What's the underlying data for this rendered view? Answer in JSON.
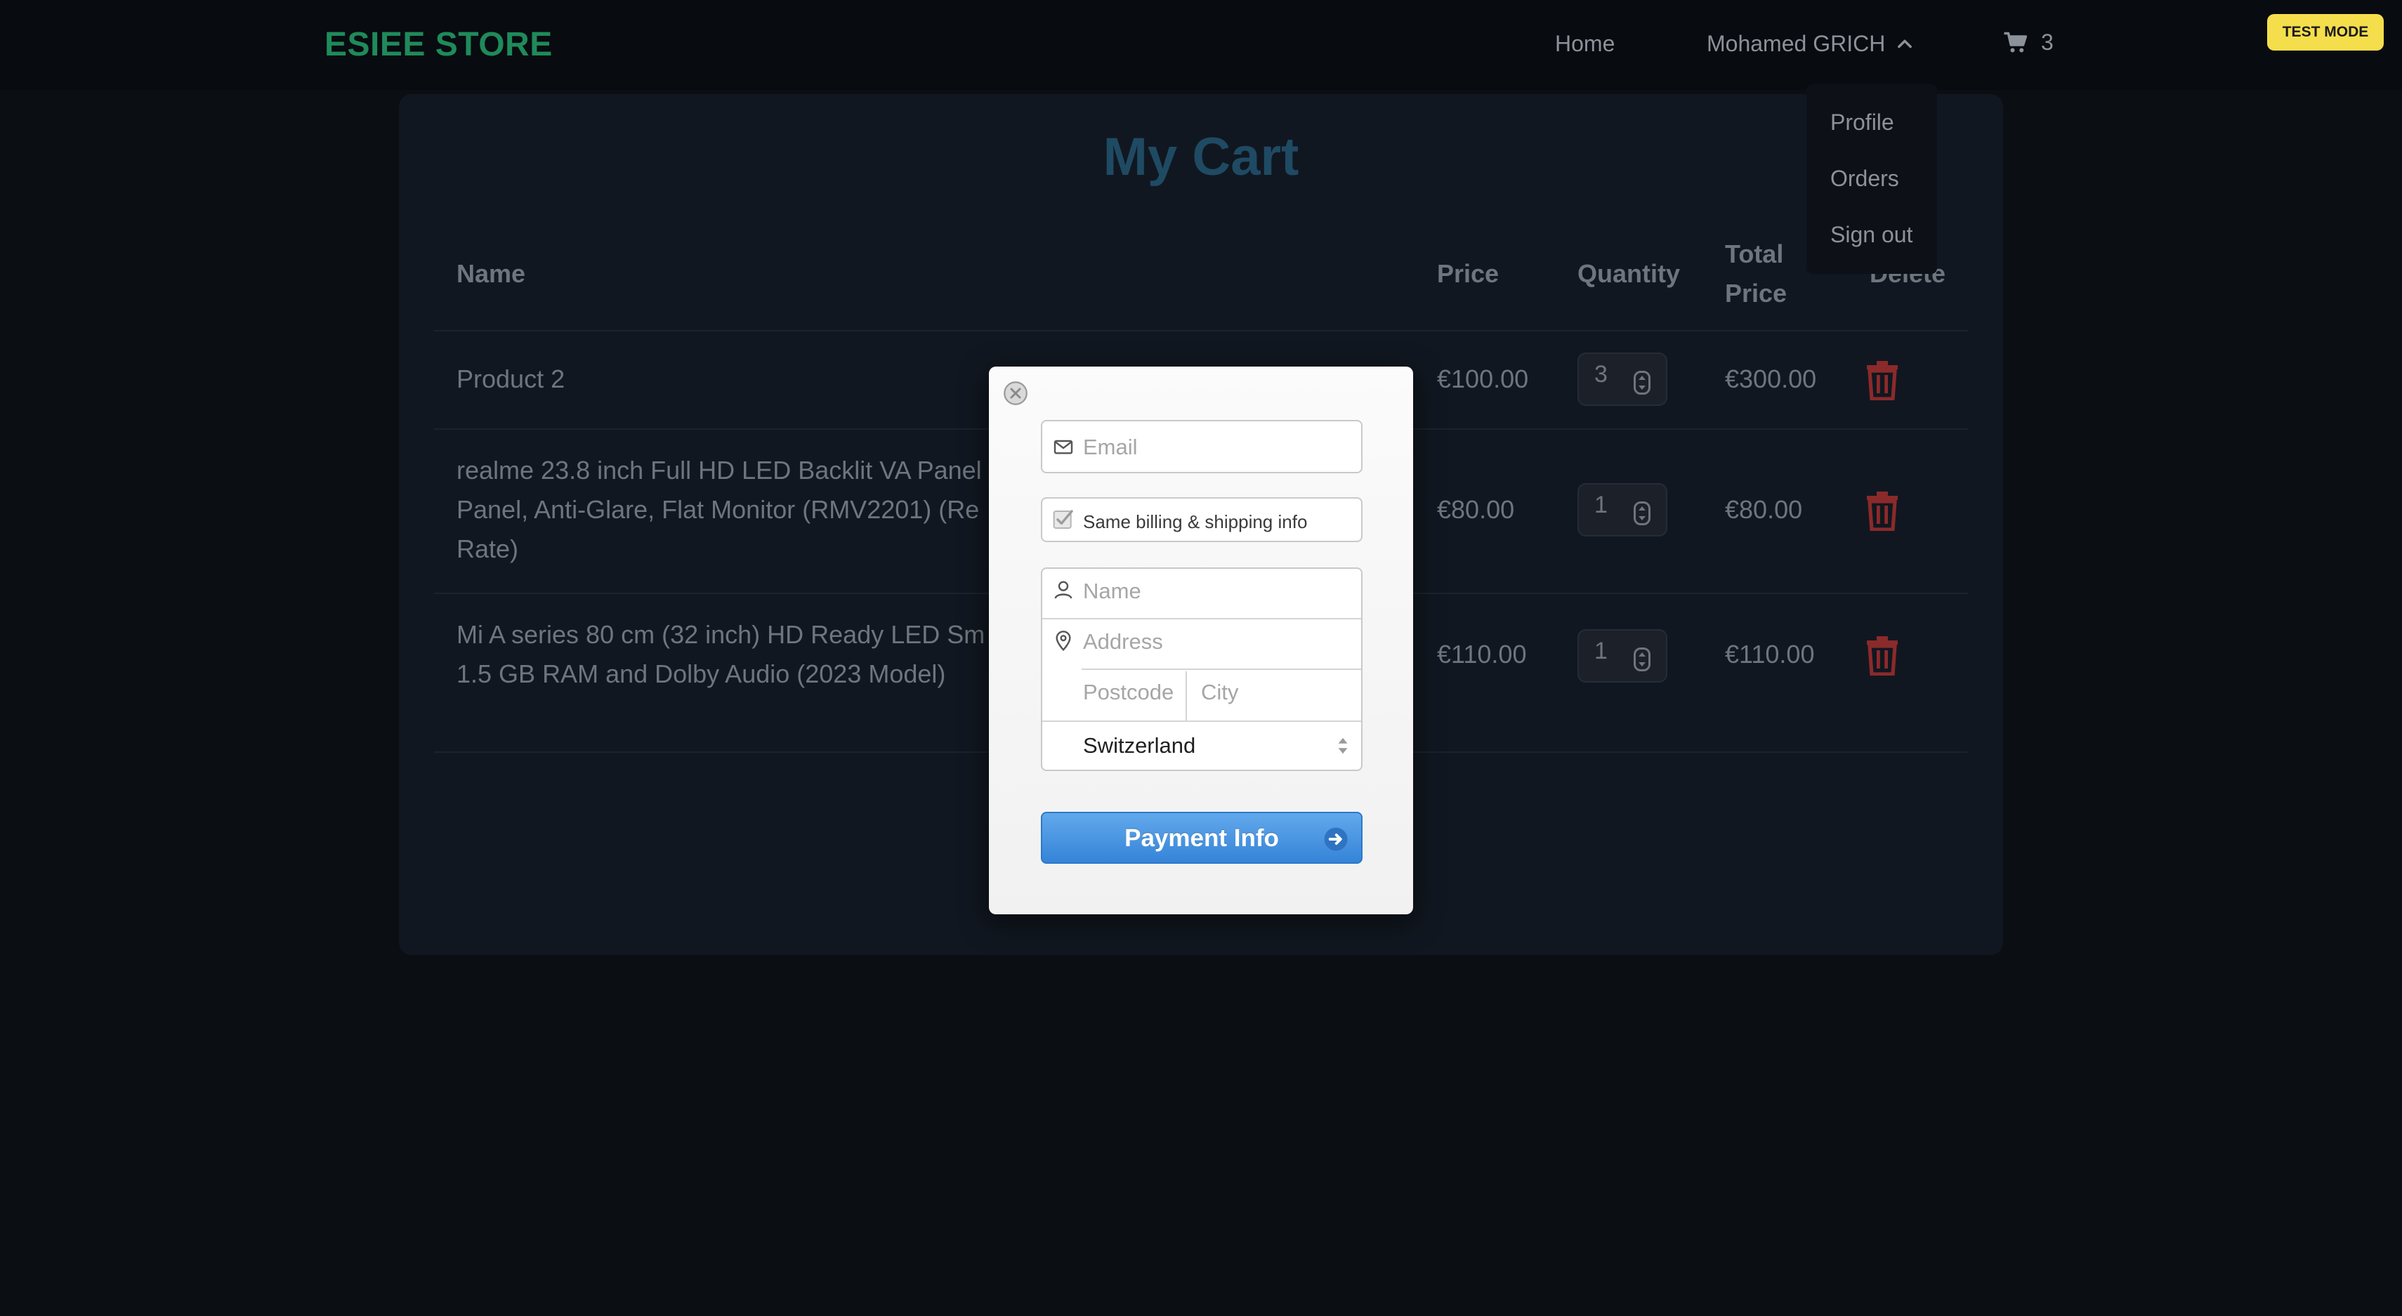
{
  "navbar": {
    "brand": "ESIEE STORE",
    "home": "Home",
    "user_name": "Mohamed GRICH",
    "cart_count": "3",
    "test_mode": "TEST MODE"
  },
  "dropdown": {
    "items": [
      "Profile",
      "Orders",
      "Sign out"
    ]
  },
  "cart": {
    "title": "My Cart",
    "headers": {
      "name": "Name",
      "price": "Price",
      "quantity": "Quantity",
      "total_line1": "Total",
      "total_line2": "Price",
      "delete": "Delete"
    },
    "rows": [
      {
        "name_lines": [
          "Product 2"
        ],
        "price": "€100.00",
        "quantity": "3",
        "total": "€300.00"
      },
      {
        "name_lines": [
          "realme 23.8 inch Full HD LED Backlit VA Panel",
          "Panel, Anti-Glare, Flat Monitor (RMV2201) (Re",
          "Rate)"
        ],
        "price": "€80.00",
        "quantity": "1",
        "total": "€80.00"
      },
      {
        "name_lines": [
          "Mi A series 80 cm (32 inch) HD Ready LED Sm",
          "1.5 GB RAM and Dolby Audio (2023 Model)"
        ],
        "price": "€110.00",
        "quantity": "1",
        "total": "€110.00"
      }
    ]
  },
  "checkout_modal": {
    "email_placeholder": "Email",
    "same_billing_label": "Same billing & shipping info",
    "same_billing_checked": true,
    "name_placeholder": "Name",
    "address_placeholder": "Address",
    "postcode_placeholder": "Postcode",
    "city_placeholder": "City",
    "country": "Switzerland",
    "submit_label": "Payment Info"
  },
  "colors": {
    "page_bg": "#0b0e13",
    "brand": "#1f8a5a",
    "title": "#1f4a63",
    "delete_icon": "#8b2a2a",
    "test_mode_bg": "#f5de4c",
    "button_blue": "#3f8fe0"
  }
}
